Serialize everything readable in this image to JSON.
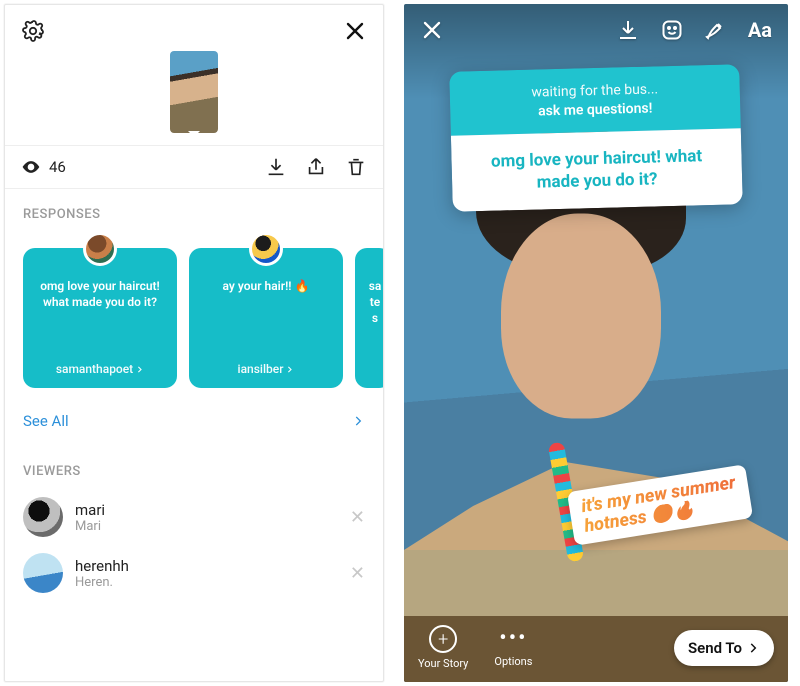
{
  "left": {
    "view_count": "46",
    "responses_title": "RESPONSES",
    "cards": [
      {
        "text": "omg love your haircut! what made you do it?",
        "user": "samanthapoet"
      },
      {
        "text": "ay your hair!! 🔥",
        "user": "iansilber"
      },
      {
        "text": "sa\nte\ns",
        "user": ""
      }
    ],
    "see_all": "See All",
    "viewers_title": "VIEWERS",
    "viewers": [
      {
        "name": "mari",
        "sub": "Mari"
      },
      {
        "name": "herenhh",
        "sub": "Heren."
      }
    ]
  },
  "right": {
    "sticker_prompt_line1": "waiting for the bus...",
    "sticker_prompt_line2": "ask me questions!",
    "sticker_answer": "omg love your haircut! what made you do it?",
    "reply_line1": "it's my new summer",
    "reply_line2": "hotness 😉🔥",
    "text_tool": "Aa",
    "your_story": "Your Story",
    "options": "Options",
    "send_to": "Send To"
  }
}
